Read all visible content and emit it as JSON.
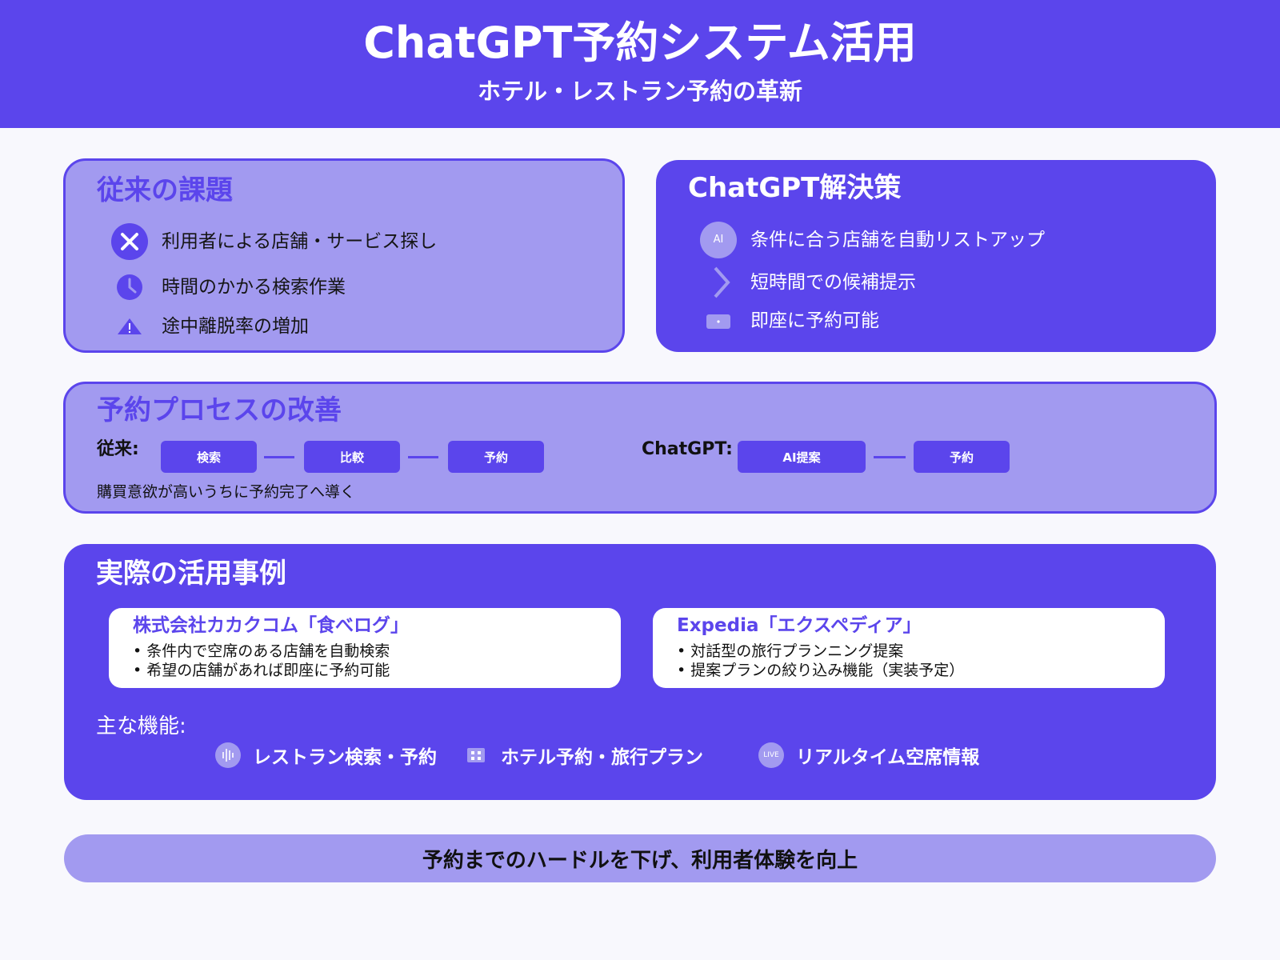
{
  "header": {
    "title": "ChatGPT予約システム活用",
    "subtitle": "ホテル・レストラン予約の革新"
  },
  "problems": {
    "title": "従来の課題",
    "items": [
      {
        "icon": "x-circle-icon",
        "text": "利用者による店舗・サービス探し"
      },
      {
        "icon": "clock-icon",
        "text": "時間のかかる検索作業"
      },
      {
        "icon": "warning-icon",
        "text": "途中離脱率の増加"
      }
    ]
  },
  "solutions": {
    "title": "ChatGPT解決策",
    "ai_badge": "AI",
    "items": [
      {
        "icon": "ai-icon",
        "text": "条件に合う店舗を自動リストアップ"
      },
      {
        "icon": "chevron-right-icon",
        "text": "短時間での候補提示"
      },
      {
        "icon": "ticket-icon",
        "text": "即座に予約可能"
      }
    ]
  },
  "process": {
    "title": "予約プロセスの改善",
    "legacy_label": "従来:",
    "legacy_steps": [
      "検索",
      "比較",
      "予約"
    ],
    "chatgpt_label": "ChatGPT:",
    "chatgpt_steps": [
      "AI提案",
      "予約"
    ],
    "note": "購買意欲が高いうちに予約完了へ導く"
  },
  "cases": {
    "title": "実際の活用事例",
    "items": [
      {
        "title": "株式会社カカクコム「食べログ」",
        "bullets": [
          "• 条件内で空席のある店舗を自動検索",
          "• 希望の店舗があれば即座に予約可能"
        ]
      },
      {
        "title": "Expedia「エクスペディア」",
        "bullets": [
          "• 対話型の旅行プランニング提案",
          "• 提案プランの絞り込み機能（実装予定）"
        ]
      }
    ],
    "features_label": "主な機能:",
    "features": [
      {
        "icon": "audio-wave-icon",
        "text": "レストラン検索・予約"
      },
      {
        "icon": "grid-icon",
        "text": "ホテル予約・旅行プラン"
      },
      {
        "icon": "live-icon",
        "text": "リアルタイム空席情報"
      }
    ],
    "live_badge": "LIVE"
  },
  "footer": {
    "text": "予約までのハードルを下げ、利用者体験を向上"
  },
  "colors": {
    "primary": "#5b45ec",
    "light": "#a29af0",
    "background": "#f8f8fd"
  }
}
